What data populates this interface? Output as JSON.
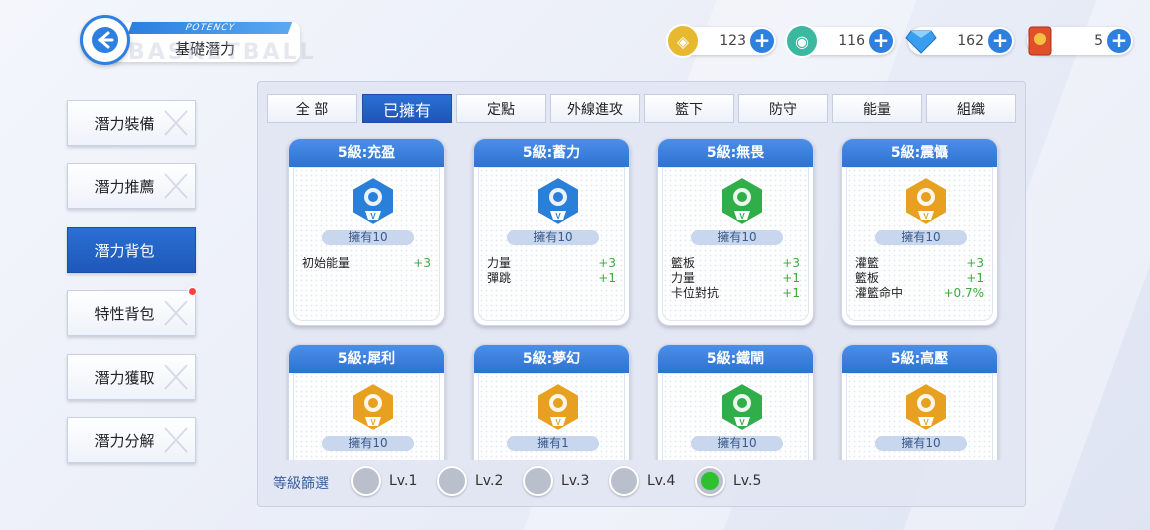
{
  "header": {
    "back_label": "←",
    "title_top": "POTENCY",
    "title": "基礎潛力",
    "watermark": "BASKETBALL"
  },
  "currencies": [
    {
      "icon": "gold-coin-icon",
      "value": "123",
      "color": "#e8b830"
    },
    {
      "icon": "green-token-icon",
      "value": "116",
      "color": "#3cb8a0"
    },
    {
      "icon": "diamond-icon",
      "value": "162",
      "color": "#3a9ef0"
    },
    {
      "icon": "ticket-card-icon",
      "value": "5",
      "color": "#e0502a"
    }
  ],
  "sidebar": {
    "items": [
      {
        "label": "潛力裝備",
        "active": false
      },
      {
        "label": "潛力推薦",
        "active": false
      },
      {
        "label": "潛力背包",
        "active": true
      },
      {
        "label": "特性背包",
        "active": false
      },
      {
        "label": "潛力獲取",
        "active": false
      },
      {
        "label": "潛力分解",
        "active": false
      }
    ]
  },
  "tabs": [
    {
      "label": "全 部",
      "active": false
    },
    {
      "label": "已擁有",
      "active": true
    },
    {
      "label": "定點",
      "active": false
    },
    {
      "label": "外線進攻",
      "active": false
    },
    {
      "label": "籃下",
      "active": false
    },
    {
      "label": "防守",
      "active": false
    },
    {
      "label": "能量",
      "active": false
    },
    {
      "label": "組織",
      "active": false
    }
  ],
  "cards": [
    {
      "title": "5級:充盈",
      "owned": "擁有10",
      "icon": "energy-fist-icon",
      "color": "#2a7fd8",
      "stats": [
        {
          "name": "初始能量",
          "value": "+3"
        }
      ]
    },
    {
      "title": "5級:蓄力",
      "owned": "擁有10",
      "icon": "shield-icon",
      "color": "#2a7fd8",
      "stats": [
        {
          "name": "力量",
          "value": "+3"
        },
        {
          "name": "彈跳",
          "value": "+1"
        }
      ]
    },
    {
      "title": "5級:無畏",
      "owned": "擁有10",
      "icon": "dumbbell-icon",
      "color": "#2fae4a",
      "stats": [
        {
          "name": "籃板",
          "value": "+3"
        },
        {
          "name": "力量",
          "value": "+1"
        },
        {
          "name": "卡位對抗",
          "value": "+1"
        }
      ]
    },
    {
      "title": "5級:震懾",
      "owned": "擁有10",
      "icon": "slam-dunk-icon",
      "color": "#e8a020",
      "stats": [
        {
          "name": "灌籃",
          "value": "+3"
        },
        {
          "name": "籃板",
          "value": "+1"
        },
        {
          "name": "灌籃命中",
          "value": "+0.7%"
        }
      ]
    },
    {
      "title": "5級:犀利",
      "owned": "擁有10",
      "icon": "hoop-icon",
      "color": "#e8a020",
      "stats": []
    },
    {
      "title": "5級:夢幻",
      "owned": "擁有1",
      "icon": "basketball-icon",
      "color": "#e8a020",
      "stats": []
    },
    {
      "title": "5級:鐵閘",
      "owned": "擁有10",
      "icon": "block-ball-icon",
      "color": "#2fae4a",
      "stats": []
    },
    {
      "title": "5級:高壓",
      "owned": "擁有10",
      "icon": "hoop-2-icon",
      "color": "#e8a020",
      "stats": []
    }
  ],
  "rank_badge": "V",
  "filter": {
    "label": "等級篩選",
    "levels": [
      {
        "label": "Lv.1",
        "selected": false
      },
      {
        "label": "Lv.2",
        "selected": false
      },
      {
        "label": "Lv.3",
        "selected": false
      },
      {
        "label": "Lv.4",
        "selected": false
      },
      {
        "label": "Lv.5",
        "selected": true
      }
    ]
  }
}
